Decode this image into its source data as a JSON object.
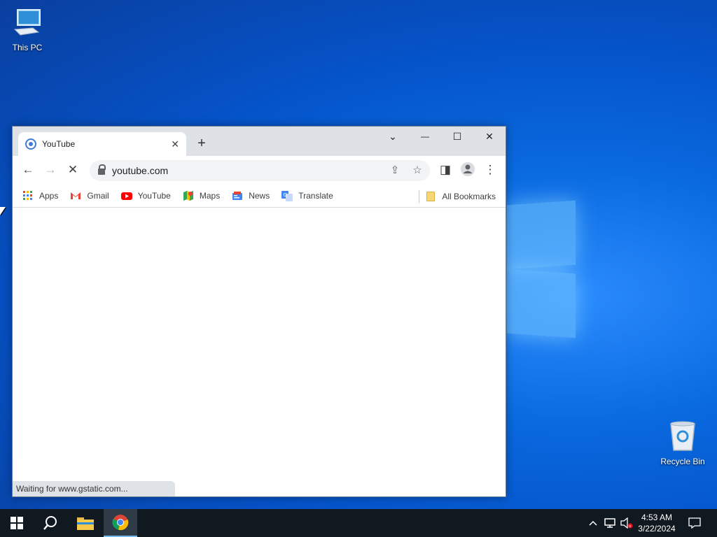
{
  "desktop": {
    "icons": [
      {
        "label": "This PC"
      },
      {
        "label": "Recycle Bin"
      }
    ]
  },
  "browser": {
    "tab": {
      "title": "YouTube",
      "close_glyph": "✕"
    },
    "new_tab_glyph": "+",
    "window_controls": {
      "tab_search": "⌄",
      "minimize": "—",
      "maximize": "☐",
      "close": "✕"
    },
    "toolbar": {
      "back": "←",
      "forward": "→",
      "stop": "✕",
      "url": "youtube.com",
      "share": "⇪",
      "bookmark_star": "☆",
      "side_panel": "◨",
      "menu": "⋮"
    },
    "bookmarks": [
      {
        "label": "Apps",
        "icon": "apps-grid-icon"
      },
      {
        "label": "Gmail",
        "icon": "gmail-icon"
      },
      {
        "label": "YouTube",
        "icon": "youtube-icon"
      },
      {
        "label": "Maps",
        "icon": "maps-icon"
      },
      {
        "label": "News",
        "icon": "news-icon"
      },
      {
        "label": "Translate",
        "icon": "translate-icon"
      }
    ],
    "all_bookmarks": "All Bookmarks",
    "status": "Waiting for www.gstatic.com..."
  },
  "taskbar": {
    "clock_time": "4:53 AM",
    "clock_date": "3/22/2024"
  },
  "colors": {
    "accent": "#0a6ae0",
    "taskbar": "#101820",
    "chrome_frame": "#dee1e6"
  }
}
